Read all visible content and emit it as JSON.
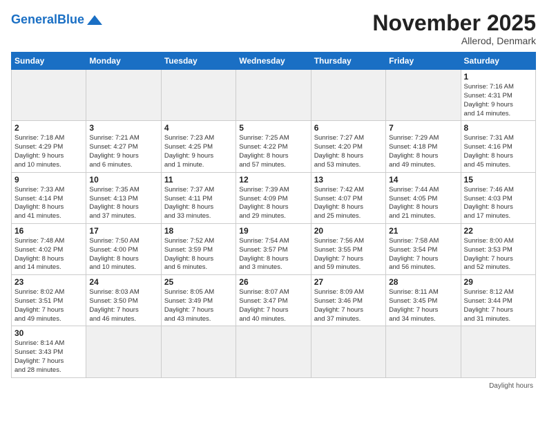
{
  "header": {
    "logo_general": "General",
    "logo_blue": "Blue",
    "month_title": "November 2025",
    "subtitle": "Allerod, Denmark"
  },
  "days_of_week": [
    "Sunday",
    "Monday",
    "Tuesday",
    "Wednesday",
    "Thursday",
    "Friday",
    "Saturday"
  ],
  "weeks": [
    [
      {
        "day": "",
        "info": ""
      },
      {
        "day": "",
        "info": ""
      },
      {
        "day": "",
        "info": ""
      },
      {
        "day": "",
        "info": ""
      },
      {
        "day": "",
        "info": ""
      },
      {
        "day": "",
        "info": ""
      },
      {
        "day": "1",
        "info": "Sunrise: 7:16 AM\nSunset: 4:31 PM\nDaylight: 9 hours\nand 14 minutes."
      }
    ],
    [
      {
        "day": "2",
        "info": "Sunrise: 7:18 AM\nSunset: 4:29 PM\nDaylight: 9 hours\nand 10 minutes."
      },
      {
        "day": "3",
        "info": "Sunrise: 7:21 AM\nSunset: 4:27 PM\nDaylight: 9 hours\nand 6 minutes."
      },
      {
        "day": "4",
        "info": "Sunrise: 7:23 AM\nSunset: 4:25 PM\nDaylight: 9 hours\nand 1 minute."
      },
      {
        "day": "5",
        "info": "Sunrise: 7:25 AM\nSunset: 4:22 PM\nDaylight: 8 hours\nand 57 minutes."
      },
      {
        "day": "6",
        "info": "Sunrise: 7:27 AM\nSunset: 4:20 PM\nDaylight: 8 hours\nand 53 minutes."
      },
      {
        "day": "7",
        "info": "Sunrise: 7:29 AM\nSunset: 4:18 PM\nDaylight: 8 hours\nand 49 minutes."
      },
      {
        "day": "8",
        "info": "Sunrise: 7:31 AM\nSunset: 4:16 PM\nDaylight: 8 hours\nand 45 minutes."
      }
    ],
    [
      {
        "day": "9",
        "info": "Sunrise: 7:33 AM\nSunset: 4:14 PM\nDaylight: 8 hours\nand 41 minutes."
      },
      {
        "day": "10",
        "info": "Sunrise: 7:35 AM\nSunset: 4:13 PM\nDaylight: 8 hours\nand 37 minutes."
      },
      {
        "day": "11",
        "info": "Sunrise: 7:37 AM\nSunset: 4:11 PM\nDaylight: 8 hours\nand 33 minutes."
      },
      {
        "day": "12",
        "info": "Sunrise: 7:39 AM\nSunset: 4:09 PM\nDaylight: 8 hours\nand 29 minutes."
      },
      {
        "day": "13",
        "info": "Sunrise: 7:42 AM\nSunset: 4:07 PM\nDaylight: 8 hours\nand 25 minutes."
      },
      {
        "day": "14",
        "info": "Sunrise: 7:44 AM\nSunset: 4:05 PM\nDaylight: 8 hours\nand 21 minutes."
      },
      {
        "day": "15",
        "info": "Sunrise: 7:46 AM\nSunset: 4:03 PM\nDaylight: 8 hours\nand 17 minutes."
      }
    ],
    [
      {
        "day": "16",
        "info": "Sunrise: 7:48 AM\nSunset: 4:02 PM\nDaylight: 8 hours\nand 14 minutes."
      },
      {
        "day": "17",
        "info": "Sunrise: 7:50 AM\nSunset: 4:00 PM\nDaylight: 8 hours\nand 10 minutes."
      },
      {
        "day": "18",
        "info": "Sunrise: 7:52 AM\nSunset: 3:59 PM\nDaylight: 8 hours\nand 6 minutes."
      },
      {
        "day": "19",
        "info": "Sunrise: 7:54 AM\nSunset: 3:57 PM\nDaylight: 8 hours\nand 3 minutes."
      },
      {
        "day": "20",
        "info": "Sunrise: 7:56 AM\nSunset: 3:55 PM\nDaylight: 7 hours\nand 59 minutes."
      },
      {
        "day": "21",
        "info": "Sunrise: 7:58 AM\nSunset: 3:54 PM\nDaylight: 7 hours\nand 56 minutes."
      },
      {
        "day": "22",
        "info": "Sunrise: 8:00 AM\nSunset: 3:53 PM\nDaylight: 7 hours\nand 52 minutes."
      }
    ],
    [
      {
        "day": "23",
        "info": "Sunrise: 8:02 AM\nSunset: 3:51 PM\nDaylight: 7 hours\nand 49 minutes."
      },
      {
        "day": "24",
        "info": "Sunrise: 8:03 AM\nSunset: 3:50 PM\nDaylight: 7 hours\nand 46 minutes."
      },
      {
        "day": "25",
        "info": "Sunrise: 8:05 AM\nSunset: 3:49 PM\nDaylight: 7 hours\nand 43 minutes."
      },
      {
        "day": "26",
        "info": "Sunrise: 8:07 AM\nSunset: 3:47 PM\nDaylight: 7 hours\nand 40 minutes."
      },
      {
        "day": "27",
        "info": "Sunrise: 8:09 AM\nSunset: 3:46 PM\nDaylight: 7 hours\nand 37 minutes."
      },
      {
        "day": "28",
        "info": "Sunrise: 8:11 AM\nSunset: 3:45 PM\nDaylight: 7 hours\nand 34 minutes."
      },
      {
        "day": "29",
        "info": "Sunrise: 8:12 AM\nSunset: 3:44 PM\nDaylight: 7 hours\nand 31 minutes."
      }
    ],
    [
      {
        "day": "30",
        "info": "Sunrise: 8:14 AM\nSunset: 3:43 PM\nDaylight: 7 hours\nand 28 minutes."
      },
      {
        "day": "",
        "info": ""
      },
      {
        "day": "",
        "info": ""
      },
      {
        "day": "",
        "info": ""
      },
      {
        "day": "",
        "info": ""
      },
      {
        "day": "",
        "info": ""
      },
      {
        "day": "",
        "info": ""
      }
    ]
  ],
  "footer": {
    "daylight_label": "Daylight hours"
  }
}
